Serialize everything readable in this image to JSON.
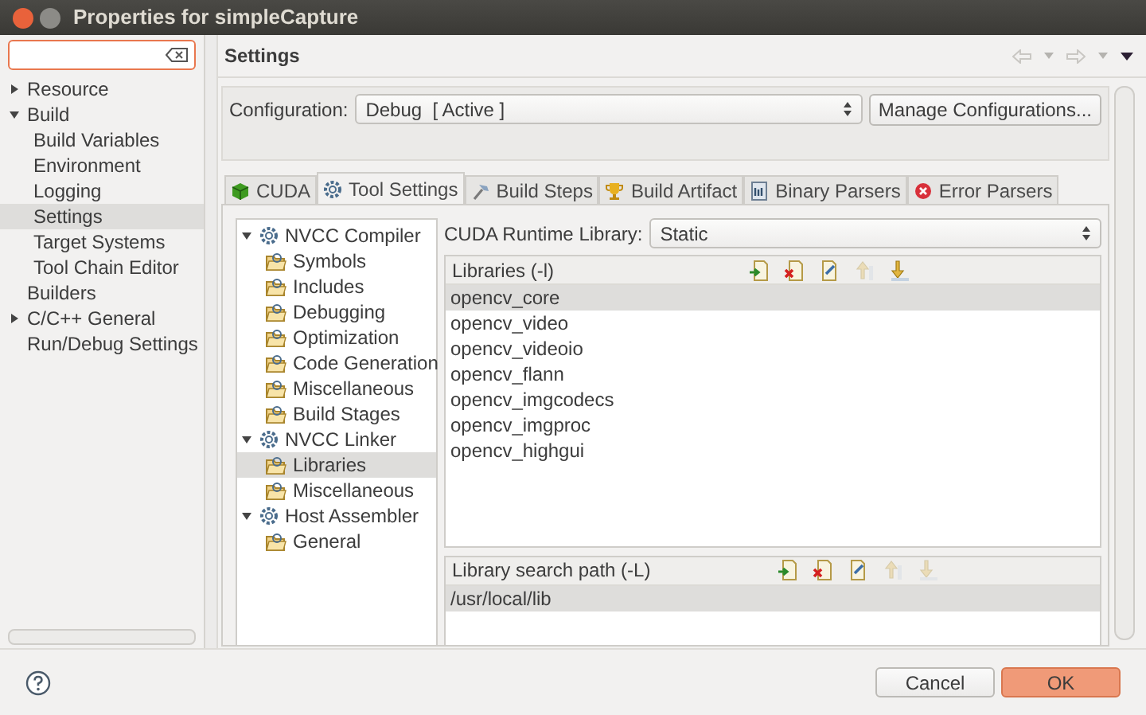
{
  "window": {
    "title": "Properties for simpleCapture"
  },
  "sidebar": {
    "items": [
      {
        "label": "Resource",
        "expanded": false,
        "selected": false
      },
      {
        "label": "Build",
        "expanded": true,
        "selected": false,
        "children": [
          {
            "label": "Build Variables",
            "selected": false
          },
          {
            "label": "Environment",
            "selected": false
          },
          {
            "label": "Logging",
            "selected": false
          },
          {
            "label": "Settings",
            "selected": true
          },
          {
            "label": "Target Systems",
            "selected": false
          },
          {
            "label": "Tool Chain Editor",
            "selected": false
          }
        ]
      },
      {
        "label": "Builders",
        "selected": false
      },
      {
        "label": "C/C++ General",
        "expanded": false,
        "selected": false
      },
      {
        "label": "Run/Debug Settings",
        "selected": false
      }
    ]
  },
  "page": {
    "title": "Settings"
  },
  "configuration": {
    "label": "Configuration:",
    "value": "Debug  [ Active ]",
    "button": "Manage Configurations..."
  },
  "tabs": [
    {
      "label": "CUDA",
      "kind": "cube",
      "selected": false
    },
    {
      "label": "Tool Settings",
      "kind": "gear",
      "selected": true
    },
    {
      "label": "Build Steps",
      "kind": "hammer",
      "selected": false
    },
    {
      "label": "Build Artifact",
      "kind": "trophy",
      "selected": false
    },
    {
      "label": "Binary Parsers",
      "kind": "binary",
      "selected": false
    },
    {
      "label": "Error Parsers",
      "kind": "error",
      "selected": false
    }
  ],
  "tool_tree": [
    {
      "label": "NVCC Compiler",
      "kind": "tool",
      "expanded": true,
      "selected": false,
      "children": [
        {
          "label": "Symbols",
          "kind": "option",
          "selected": false
        },
        {
          "label": "Includes",
          "kind": "option",
          "selected": false
        },
        {
          "label": "Debugging",
          "kind": "option",
          "selected": false
        },
        {
          "label": "Optimization",
          "kind": "option",
          "selected": false
        },
        {
          "label": "Code Generation",
          "kind": "option",
          "selected": false
        },
        {
          "label": "Miscellaneous",
          "kind": "option",
          "selected": false
        },
        {
          "label": "Build Stages",
          "kind": "option",
          "selected": false
        }
      ]
    },
    {
      "label": "NVCC Linker",
      "kind": "tool",
      "expanded": true,
      "selected": false,
      "children": [
        {
          "label": "Libraries",
          "kind": "option",
          "selected": true
        },
        {
          "label": "Miscellaneous",
          "kind": "option",
          "selected": false
        }
      ]
    },
    {
      "label": "Host Assembler",
      "kind": "tool",
      "expanded": true,
      "selected": false,
      "children": [
        {
          "label": "General",
          "kind": "option",
          "selected": false
        }
      ]
    }
  ],
  "runtime": {
    "label": "CUDA Runtime Library:",
    "value": "Static"
  },
  "libraries": {
    "title": "Libraries (-l)",
    "tools": [
      {
        "kind": "add",
        "disabled": false
      },
      {
        "kind": "delete",
        "disabled": false
      },
      {
        "kind": "edit",
        "disabled": false
      },
      {
        "kind": "up",
        "disabled": true
      },
      {
        "kind": "down",
        "disabled": false
      }
    ],
    "items": [
      {
        "label": "opencv_core",
        "selected": true
      },
      {
        "label": "opencv_video",
        "selected": false
      },
      {
        "label": "opencv_videoio",
        "selected": false
      },
      {
        "label": "opencv_flann",
        "selected": false
      },
      {
        "label": "opencv_imgcodecs",
        "selected": false
      },
      {
        "label": "opencv_imgproc",
        "selected": false
      },
      {
        "label": "opencv_highgui",
        "selected": false
      }
    ]
  },
  "search_paths": {
    "title": "Library search path (-L)",
    "tools": [
      {
        "kind": "add",
        "disabled": false
      },
      {
        "kind": "delete",
        "disabled": false
      },
      {
        "kind": "edit",
        "disabled": false
      },
      {
        "kind": "up",
        "disabled": true
      },
      {
        "kind": "down",
        "disabled": true
      }
    ],
    "items": [
      {
        "label": "/usr/local/lib",
        "selected": true
      }
    ]
  },
  "buttons": [
    {
      "label": "Cancel",
      "kind": "default"
    },
    {
      "label": "OK",
      "kind": "primary"
    }
  ]
}
